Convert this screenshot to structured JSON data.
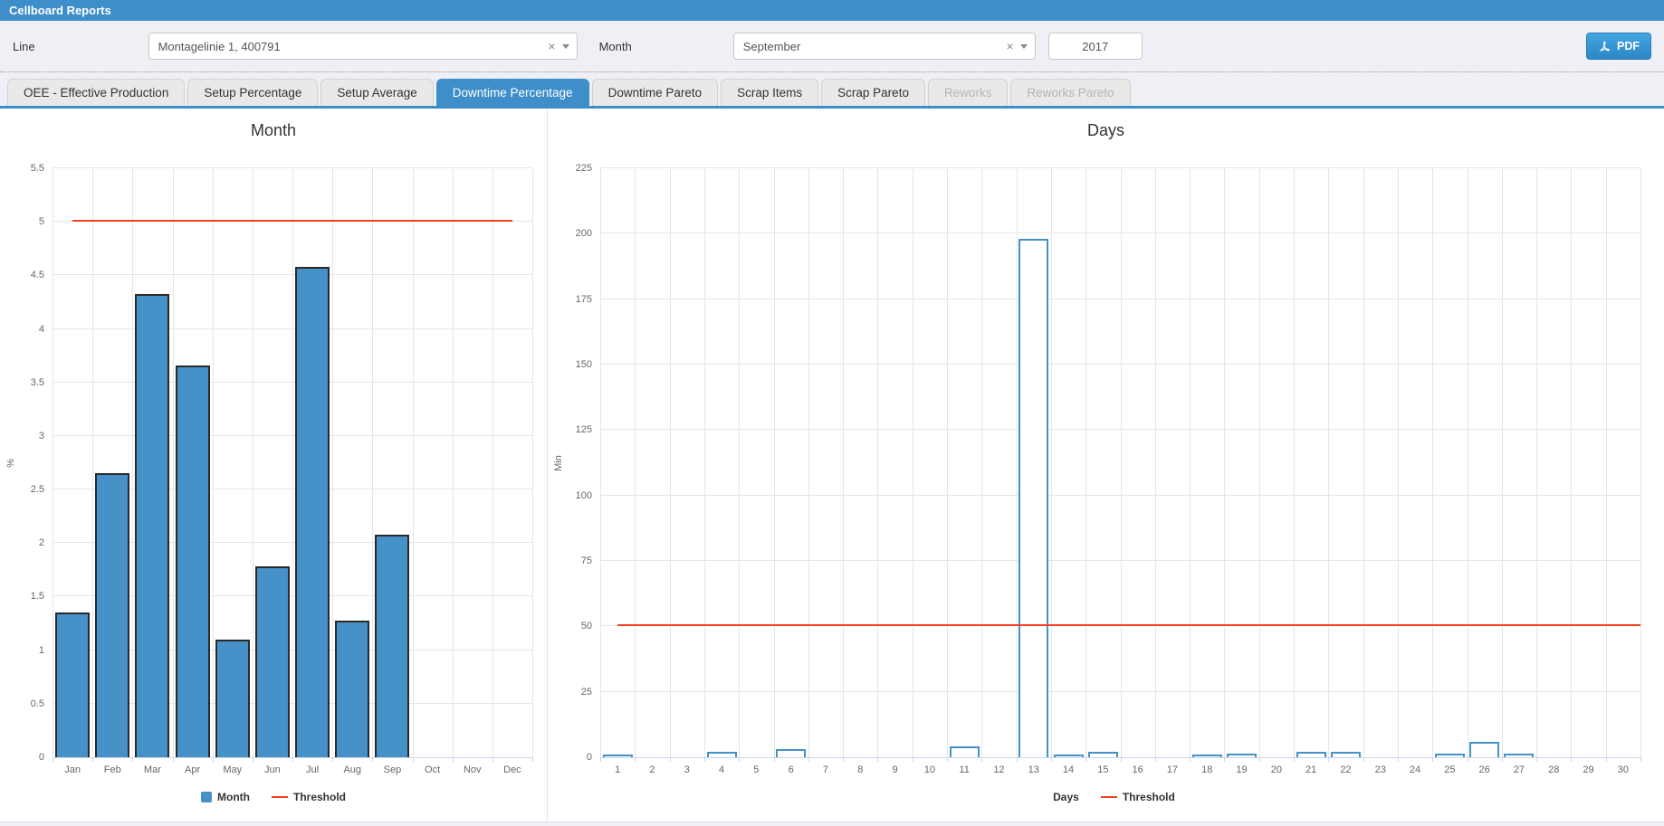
{
  "window": {
    "title": "Cellboard Reports"
  },
  "filters": {
    "line_label": "Line",
    "line_value": "Montagelinie 1, 400791",
    "month_label": "Month",
    "month_value": "September",
    "year_value": "2017",
    "pdf_label": "PDF",
    "clear_icon": "×"
  },
  "tabs": [
    {
      "label": "OEE - Effective Production",
      "state": "normal"
    },
    {
      "label": "Setup Percentage",
      "state": "normal"
    },
    {
      "label": "Setup Average",
      "state": "normal"
    },
    {
      "label": "Downtime Percentage",
      "state": "active"
    },
    {
      "label": "Downtime Pareto",
      "state": "normal"
    },
    {
      "label": "Scrap Items",
      "state": "normal"
    },
    {
      "label": "Scrap Pareto",
      "state": "normal"
    },
    {
      "label": "Reworks",
      "state": "disabled"
    },
    {
      "label": "Reworks Pareto",
      "state": "disabled"
    }
  ],
  "colors": {
    "accent": "#3e8ec9",
    "bar_fill": "#4591c8",
    "bar_stroke": "#2a2a2a",
    "threshold": "#f2401e",
    "gridline": "#e6e6e6",
    "axis_line": "#ccd6eb"
  },
  "chart_data": [
    {
      "type": "bar",
      "title": "Month",
      "ylabel": "%",
      "xlabel": "",
      "categories": [
        "Jan",
        "Feb",
        "Mar",
        "Apr",
        "May",
        "Jun",
        "Jul",
        "Aug",
        "Sep",
        "Oct",
        "Nov",
        "Dec"
      ],
      "values": [
        1.35,
        2.65,
        4.33,
        3.66,
        1.1,
        1.78,
        4.58,
        1.28,
        2.08,
        0,
        0,
        0
      ],
      "threshold": 5,
      "ylim": [
        0,
        5.5
      ],
      "ytick_step": 0.5,
      "grid": true,
      "bar_style": "filled",
      "threshold_to_right_edge": false,
      "legend_position": "bottom-center",
      "legend": [
        {
          "label": "Month",
          "swatch": "square"
        },
        {
          "label": "Threshold",
          "swatch": "line"
        }
      ]
    },
    {
      "type": "bar",
      "title": "Days",
      "ylabel": "Min",
      "xlabel": "",
      "categories": [
        "1",
        "2",
        "3",
        "4",
        "5",
        "6",
        "7",
        "8",
        "9",
        "10",
        "11",
        "12",
        "13",
        "14",
        "15",
        "16",
        "17",
        "18",
        "19",
        "20",
        "21",
        "22",
        "23",
        "24",
        "25",
        "26",
        "27",
        "28",
        "29",
        "30"
      ],
      "values": [
        1,
        0,
        0,
        2,
        0,
        3,
        0,
        0,
        0,
        0,
        4,
        0,
        198,
        1,
        2,
        0,
        0,
        1,
        1.5,
        0,
        2,
        2,
        0,
        0,
        1.5,
        6,
        1.5,
        0,
        0,
        0
      ],
      "threshold": 50,
      "ylim": [
        0,
        225
      ],
      "ytick_step": 25,
      "grid": true,
      "bar_style": "outline",
      "threshold_to_right_edge": true,
      "legend_position": "bottom-center",
      "legend": [
        {
          "label": "Days",
          "swatch": "square-white"
        },
        {
          "label": "Threshold",
          "swatch": "line"
        }
      ]
    }
  ]
}
